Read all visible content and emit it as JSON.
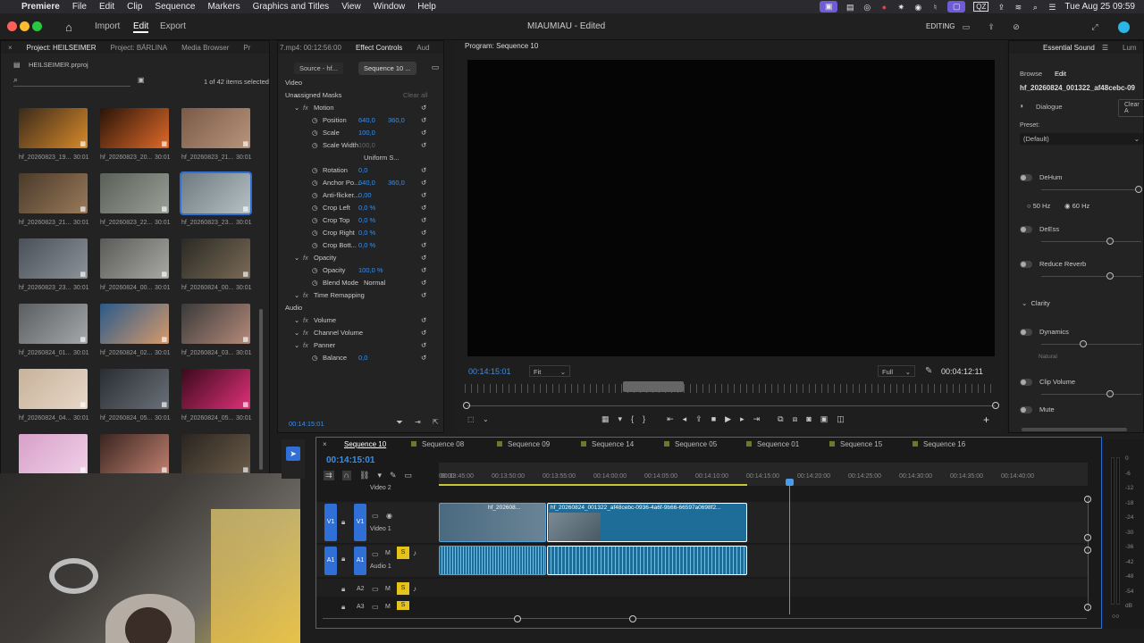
{
  "menubar": {
    "app": "Premiere",
    "items": [
      "File",
      "Edit",
      "Clip",
      "Sequence",
      "Markers",
      "Graphics and Titles",
      "View",
      "Window",
      "Help"
    ],
    "clock": "Tue Aug 25  09:59",
    "qz": "QZ"
  },
  "workspace": {
    "tabs": [
      "Import",
      "Edit",
      "Export"
    ],
    "title": "MIAUMIAU - Edited",
    "mode": "EDITING"
  },
  "project": {
    "tabs": [
      "Project: HEILSEIMER",
      "Project: BÄRLINA",
      "Media Browser",
      "Pr"
    ],
    "file": "HEILSEIMER.prproj",
    "selection": "1 of 42 items selected",
    "items": [
      {
        "name": "hf_20260823_19...",
        "dur": "30:01",
        "c1": "#3a2a1a",
        "c2": "#d88a2a"
      },
      {
        "name": "hf_20260823_20...",
        "dur": "30:01",
        "c1": "#2a1508",
        "c2": "#e0692a"
      },
      {
        "name": "hf_20260823_21...",
        "dur": "30:01",
        "c1": "#7a5a48",
        "c2": "#b8947a"
      },
      {
        "name": "hf_20260823_21...",
        "dur": "30:01",
        "c1": "#4a3a2a",
        "c2": "#9a7a5a"
      },
      {
        "name": "hf_20260823_22...",
        "dur": "30:01",
        "c1": "#5a5f58",
        "c2": "#9aa098"
      },
      {
        "name": "hf_20260823_23...",
        "dur": "30:01",
        "c1": "#6f7a80",
        "c2": "#b6c1c6"
      },
      {
        "name": "hf_20260823_23...",
        "dur": "30:01",
        "c1": "#4a5058",
        "c2": "#8c929a"
      },
      {
        "name": "hf_20260824_00...",
        "dur": "30:01",
        "c1": "#5a5a58",
        "c2": "#a8a8a4"
      },
      {
        "name": "hf_20260824_00...",
        "dur": "30:01",
        "c1": "#2a2a25",
        "c2": "#7a6a55"
      },
      {
        "name": "hf_20260824_01...",
        "dur": "30:01",
        "c1": "#5a5e60",
        "c2": "#a4a8aa"
      },
      {
        "name": "hf_20260824_02...",
        "dur": "30:01",
        "c1": "#2a5a8a",
        "c2": "#d89a6a"
      },
      {
        "name": "hf_20260824_03...",
        "dur": "30:01",
        "c1": "#3a3a3a",
        "c2": "#b58a7a"
      },
      {
        "name": "hf_20260824_04...",
        "dur": "30:01",
        "c1": "#c7b29a",
        "c2": "#e8d8c8"
      },
      {
        "name": "hf_20260824_05...",
        "dur": "30:01",
        "c1": "#2a2e33",
        "c2": "#6a7078"
      },
      {
        "name": "hf_20260824_05...",
        "dur": "30:01",
        "c1": "#3a0a1a",
        "c2": "#e0307a"
      },
      {
        "name": "",
        "dur": "",
        "c1": "#d8a0c8",
        "c2": "#f0d0e8"
      },
      {
        "name": "",
        "dur": "",
        "c1": "#3a2520",
        "c2": "#c08070"
      },
      {
        "name": "",
        "dur": "",
        "c1": "#2a2520",
        "c2": "#6a5a48"
      }
    ]
  },
  "effects": {
    "tabs": [
      "7.mp4: 00:12:56:00",
      "Effect Controls",
      "Aud"
    ],
    "source": "Source - hf...",
    "sequence": "Sequence 10 ...",
    "rows": [
      {
        "label": "Video",
        "v1": "",
        "v2": "",
        "indent": 0
      },
      {
        "label": "Unassigned Masks",
        "v1": "Clear all",
        "v2": "",
        "indent": 0
      },
      {
        "label": "Motion",
        "v1": "",
        "v2": "",
        "indent": 1
      },
      {
        "label": "Position",
        "v1": "640,0",
        "v2": "360,0",
        "indent": 2
      },
      {
        "label": "Scale",
        "v1": "100,0",
        "v2": "",
        "indent": 2
      },
      {
        "label": "Scale Width",
        "v1": "100,0",
        "v2": "",
        "indent": 2
      },
      {
        "label": "Uniform S...",
        "v1": "",
        "v2": "",
        "indent": 3
      },
      {
        "label": "Rotation",
        "v1": "0,0",
        "v2": "",
        "indent": 2
      },
      {
        "label": "Anchor Po...",
        "v1": "640,0",
        "v2": "360,0",
        "indent": 2
      },
      {
        "label": "Anti-flicker...",
        "v1": "0,00",
        "v2": "",
        "indent": 2
      },
      {
        "label": "Crop Left",
        "v1": "0,0 %",
        "v2": "",
        "indent": 2
      },
      {
        "label": "Crop Top",
        "v1": "0,0 %",
        "v2": "",
        "indent": 2
      },
      {
        "label": "Crop Right",
        "v1": "0,0 %",
        "v2": "",
        "indent": 2
      },
      {
        "label": "Crop Bott...",
        "v1": "0,0 %",
        "v2": "",
        "indent": 2
      },
      {
        "label": "Opacity",
        "v1": "",
        "v2": "",
        "indent": 1
      },
      {
        "label": "Opacity",
        "v1": "100,0 %",
        "v2": "",
        "indent": 2
      },
      {
        "label": "Blend Mode",
        "v1": "Normal",
        "v2": "",
        "indent": 2
      },
      {
        "label": "Time Remapping",
        "v1": "",
        "v2": "",
        "indent": 1
      },
      {
        "label": "Audio",
        "v1": "",
        "v2": "",
        "indent": 0
      },
      {
        "label": "Volume",
        "v1": "",
        "v2": "",
        "indent": 1
      },
      {
        "label": "Channel Volume",
        "v1": "",
        "v2": "",
        "indent": 1
      },
      {
        "label": "Panner",
        "v1": "",
        "v2": "",
        "indent": 1
      },
      {
        "label": "Balance",
        "v1": "0,0",
        "v2": "",
        "indent": 2
      }
    ],
    "timecode": "00:14:15:01"
  },
  "program": {
    "title": "Program: Sequence 10",
    "timecode": "00:14:15:01",
    "fit": "Fit",
    "quality": "Full",
    "duration": "00:04:12:11"
  },
  "essential": {
    "title": "Essential Sound",
    "other_tab": "Lum",
    "tabs": [
      "Browse",
      "Edit"
    ],
    "clip": "hf_20260824_001322_af48cebc-09",
    "type": "Dialogue",
    "clear": "Clear A",
    "preset_label": "Preset:",
    "preset": "(Default)",
    "dehum": "DeHum",
    "hz50": "50 Hz",
    "hz60": "60 Hz",
    "deess": "DeEss",
    "reverb": "Reduce Reverb",
    "clarity": "Clarity",
    "dynamics": "Dynamics",
    "natural": "Natural",
    "clipvol": "Clip Volume",
    "mute": "Mute"
  },
  "timeline": {
    "tabs": [
      "Sequence 10",
      "Sequence 08",
      "Sequence 09",
      "Sequence 14",
      "Sequence 05",
      "Sequence 01",
      "Sequence 15",
      "Sequence 16"
    ],
    "timecode": "00:14:15:01",
    "ruler": [
      "00:00",
      "00:13:45:00",
      "00:13:50:00",
      "00:13:55:00",
      "00:14:00:00",
      "00:14:05:00",
      "00:14:10:00",
      "00:14:15:00",
      "00:14:20:00",
      "00:14:25:00",
      "00:14:30:00",
      "00:14:35:00",
      "00:14:40:00"
    ],
    "tracks": {
      "v2": "Video 2",
      "v1": "Video 1",
      "a1": "Audio 1"
    },
    "btn_v1": "V1",
    "btn_a1": "A1",
    "btn_a2": "A2",
    "btn_a3": "A3",
    "btn_m": "M",
    "btn_s": "S",
    "clip_short": "hf_202608...",
    "clip_main": "hf_20260824_001322_af48cebc-0936-4a6f-9b66-66597a0698f2...",
    "meter": [
      "0",
      "-6",
      "-12",
      "-18",
      "-24",
      "-30",
      "-36",
      "-42",
      "-48",
      "-54",
      "dB"
    ]
  }
}
